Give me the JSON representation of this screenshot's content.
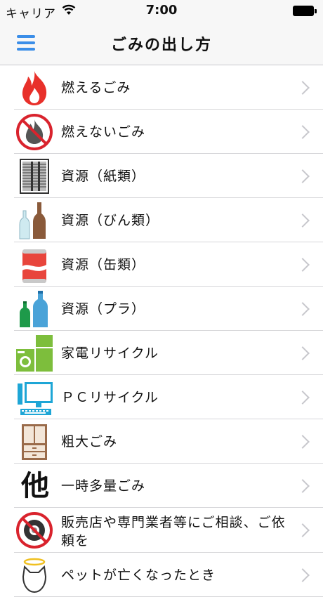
{
  "status": {
    "carrier": "キャリア",
    "time": "7:00"
  },
  "nav": {
    "title": "ごみの出し方"
  },
  "items": [
    {
      "label": "燃えるごみ",
      "icon": "fire-icon"
    },
    {
      "label": "燃えないごみ",
      "icon": "no-fire-icon"
    },
    {
      "label": "資源（紙類）",
      "icon": "paper-bundle-icon"
    },
    {
      "label": "資源（びん類）",
      "icon": "bottles-icon"
    },
    {
      "label": "資源（缶類）",
      "icon": "can-icon"
    },
    {
      "label": "資源（プラ）",
      "icon": "plastic-bottles-icon"
    },
    {
      "label": "家電リサイクル",
      "icon": "appliances-icon"
    },
    {
      "label": "ＰＣリサイクル",
      "icon": "computer-icon"
    },
    {
      "label": "粗大ごみ",
      "icon": "cabinet-icon"
    },
    {
      "label": "一時多量ごみ",
      "icon": "other-icon",
      "glyph": "他"
    },
    {
      "label": "販売店や専門業者等にご相談、ご依頼を",
      "icon": "no-tire-icon"
    },
    {
      "label": "ペットが亡くなったとき",
      "icon": "pet-icon"
    }
  ],
  "colors": {
    "accent": "#3b8ee8",
    "fire": "#e8302a",
    "prohibited": "#d9232d"
  }
}
